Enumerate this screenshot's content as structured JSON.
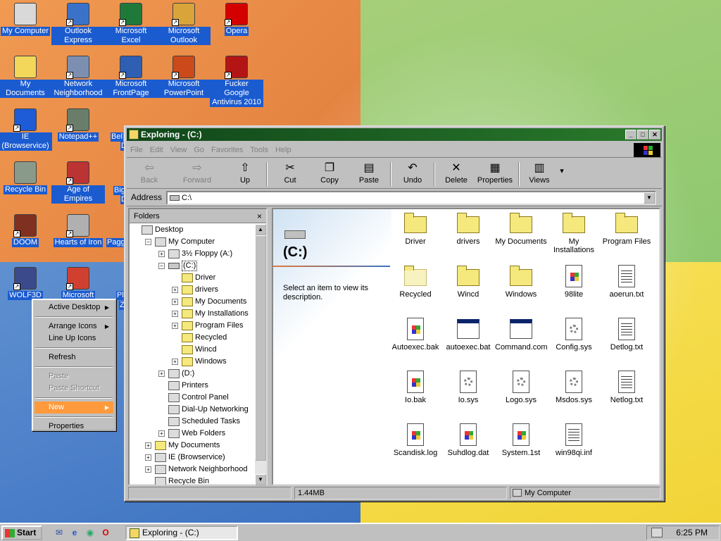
{
  "desktop_icons": [
    {
      "label": "My Computer",
      "icon": "computer-icon"
    },
    {
      "label": "Outlook Express",
      "icon": "outlook-express-icon"
    },
    {
      "label": "Microsoft Excel",
      "icon": "excel-icon"
    },
    {
      "label": "Microsoft Outlook",
      "icon": "outlook-icon"
    },
    {
      "label": "Opera",
      "icon": "opera-icon"
    },
    {
      "label": "My Documents",
      "icon": "folder-docs-icon"
    },
    {
      "label": "Network Neighborhood",
      "icon": "network-icon"
    },
    {
      "label": "Microsoft FrontPage",
      "icon": "frontpage-icon"
    },
    {
      "label": "Microsoft PowerPoint",
      "icon": "powerpoint-icon"
    },
    {
      "label": "Fucker Google Antivirus 2010",
      "icon": "antivirus-icon"
    },
    {
      "label": "IE (Browservice)",
      "icon": "ie-icon"
    },
    {
      "label": "Notepad++",
      "icon": "notepad-icon"
    },
    {
      "label": "Recycle Bin",
      "icon": "recycle-bin-icon"
    },
    {
      "label": "Age of Empires",
      "icon": "game-icon"
    },
    {
      "label": "DOOM",
      "icon": "doom-icon"
    },
    {
      "label": "Hearts of Iron",
      "icon": "hoi-icon"
    },
    {
      "label": "WOLF3D",
      "icon": "wolf3d-icon"
    },
    {
      "label": "Microsoft",
      "icon": "office-icon"
    }
  ],
  "desktop_partial_labels": [
    "Bel",
    "D",
    "Big",
    "D",
    "Pagg",
    "Pl",
    "Z"
  ],
  "context_menu": {
    "items": [
      {
        "label": "Active Desktop",
        "submenu": true,
        "disabled": false
      },
      {
        "sep": true
      },
      {
        "label": "Arrange Icons",
        "submenu": true,
        "disabled": false
      },
      {
        "label": "Line Up Icons",
        "submenu": false,
        "disabled": false
      },
      {
        "sep": true
      },
      {
        "label": "Refresh",
        "submenu": false,
        "disabled": false
      },
      {
        "sep": true
      },
      {
        "label": "Paste",
        "submenu": false,
        "disabled": true
      },
      {
        "label": "Paste Shortcut",
        "submenu": false,
        "disabled": true
      },
      {
        "sep": true
      },
      {
        "label": "New",
        "submenu": true,
        "disabled": false,
        "highlighted": true
      },
      {
        "sep": true
      },
      {
        "label": "Properties",
        "submenu": false,
        "disabled": false
      }
    ]
  },
  "window": {
    "title": "Exploring -  (C:)",
    "menu": [
      "File",
      "Edit",
      "View",
      "Go",
      "Favorites",
      "Tools",
      "Help"
    ],
    "toolbar": {
      "back": "Back",
      "forward": "Forward",
      "up": "Up",
      "cut": "Cut",
      "copy": "Copy",
      "paste": "Paste",
      "undo": "Undo",
      "delete": "Delete",
      "properties": "Properties",
      "views": "Views"
    },
    "address_label": "Address",
    "address_value": "C:\\",
    "folders_title": "Folders",
    "folders_close": "×",
    "tree": [
      {
        "label": "Desktop",
        "level": 0,
        "toggle": "",
        "icon": "desktop-icon"
      },
      {
        "label": "My Computer",
        "level": 1,
        "toggle": "-",
        "icon": "computer-icon"
      },
      {
        "label": "3½ Floppy (A:)",
        "level": 2,
        "toggle": "+",
        "icon": "floppy-icon"
      },
      {
        "label": "(C:)",
        "level": 2,
        "toggle": "-",
        "icon": "drive-icon",
        "selected": true
      },
      {
        "label": "Driver",
        "level": 3,
        "toggle": "",
        "icon": "folder-icon"
      },
      {
        "label": "drivers",
        "level": 3,
        "toggle": "+",
        "icon": "folder-icon"
      },
      {
        "label": "My Documents",
        "level": 3,
        "toggle": "+",
        "icon": "folder-icon"
      },
      {
        "label": "My Installations",
        "level": 3,
        "toggle": "+",
        "icon": "folder-icon"
      },
      {
        "label": "Program Files",
        "level": 3,
        "toggle": "+",
        "icon": "folder-icon"
      },
      {
        "label": "Recycled",
        "level": 3,
        "toggle": "",
        "icon": "folder-icon"
      },
      {
        "label": "Wincd",
        "level": 3,
        "toggle": "",
        "icon": "folder-icon"
      },
      {
        "label": "Windows",
        "level": 3,
        "toggle": "+",
        "icon": "folder-icon"
      },
      {
        "label": "(D:)",
        "level": 2,
        "toggle": "+",
        "icon": "cdrom-icon"
      },
      {
        "label": "Printers",
        "level": 2,
        "toggle": "",
        "icon": "printers-icon"
      },
      {
        "label": "Control Panel",
        "level": 2,
        "toggle": "",
        "icon": "control-panel-icon"
      },
      {
        "label": "Dial-Up Networking",
        "level": 2,
        "toggle": "",
        "icon": "dialup-icon"
      },
      {
        "label": "Scheduled Tasks",
        "level": 2,
        "toggle": "",
        "icon": "tasks-icon"
      },
      {
        "label": "Web Folders",
        "level": 2,
        "toggle": "+",
        "icon": "web-folders-icon"
      },
      {
        "label": "My Documents",
        "level": 1,
        "toggle": "+",
        "icon": "folder-icon"
      },
      {
        "label": "IE (Browservice)",
        "level": 1,
        "toggle": "+",
        "icon": "ie-icon"
      },
      {
        "label": "Network Neighborhood",
        "level": 1,
        "toggle": "+",
        "icon": "network-icon"
      },
      {
        "label": "Recycle Bin",
        "level": 1,
        "toggle": "",
        "icon": "recycle-bin-icon"
      }
    ],
    "webview": {
      "title": "(C:)",
      "description": "Select an item to view its description."
    },
    "files": [
      {
        "name": "Driver",
        "type": "folder"
      },
      {
        "name": "drivers",
        "type": "folder"
      },
      {
        "name": "My Documents",
        "type": "folder"
      },
      {
        "name": "My Installations",
        "type": "folder"
      },
      {
        "name": "Program Files",
        "type": "folder"
      },
      {
        "name": "Recycled",
        "type": "ghost-folder"
      },
      {
        "name": "Wincd",
        "type": "folder"
      },
      {
        "name": "Windows",
        "type": "folder"
      },
      {
        "name": "98lite",
        "type": "app"
      },
      {
        "name": "aoerun.txt",
        "type": "text"
      },
      {
        "name": "Autoexec.bak",
        "type": "app"
      },
      {
        "name": "autoexec.bat",
        "type": "batch"
      },
      {
        "name": "Command.com",
        "type": "exe"
      },
      {
        "name": "Config.sys",
        "type": "sys"
      },
      {
        "name": "Detlog.txt",
        "type": "text"
      },
      {
        "name": "Io.bak",
        "type": "app"
      },
      {
        "name": "Io.sys",
        "type": "sys"
      },
      {
        "name": "Logo.sys",
        "type": "sys"
      },
      {
        "name": "Msdos.sys",
        "type": "sys"
      },
      {
        "name": "Netlog.txt",
        "type": "text"
      },
      {
        "name": "Scandisk.log",
        "type": "app"
      },
      {
        "name": "Suhdlog.dat",
        "type": "app"
      },
      {
        "name": "System.1st",
        "type": "app"
      },
      {
        "name": "win98qi.inf",
        "type": "inf"
      }
    ],
    "status_size": "1.44MB",
    "status_location": "My Computer"
  },
  "taskbar": {
    "start": "Start",
    "task": "Exploring -  (C:)",
    "clock": "6:25 PM"
  }
}
